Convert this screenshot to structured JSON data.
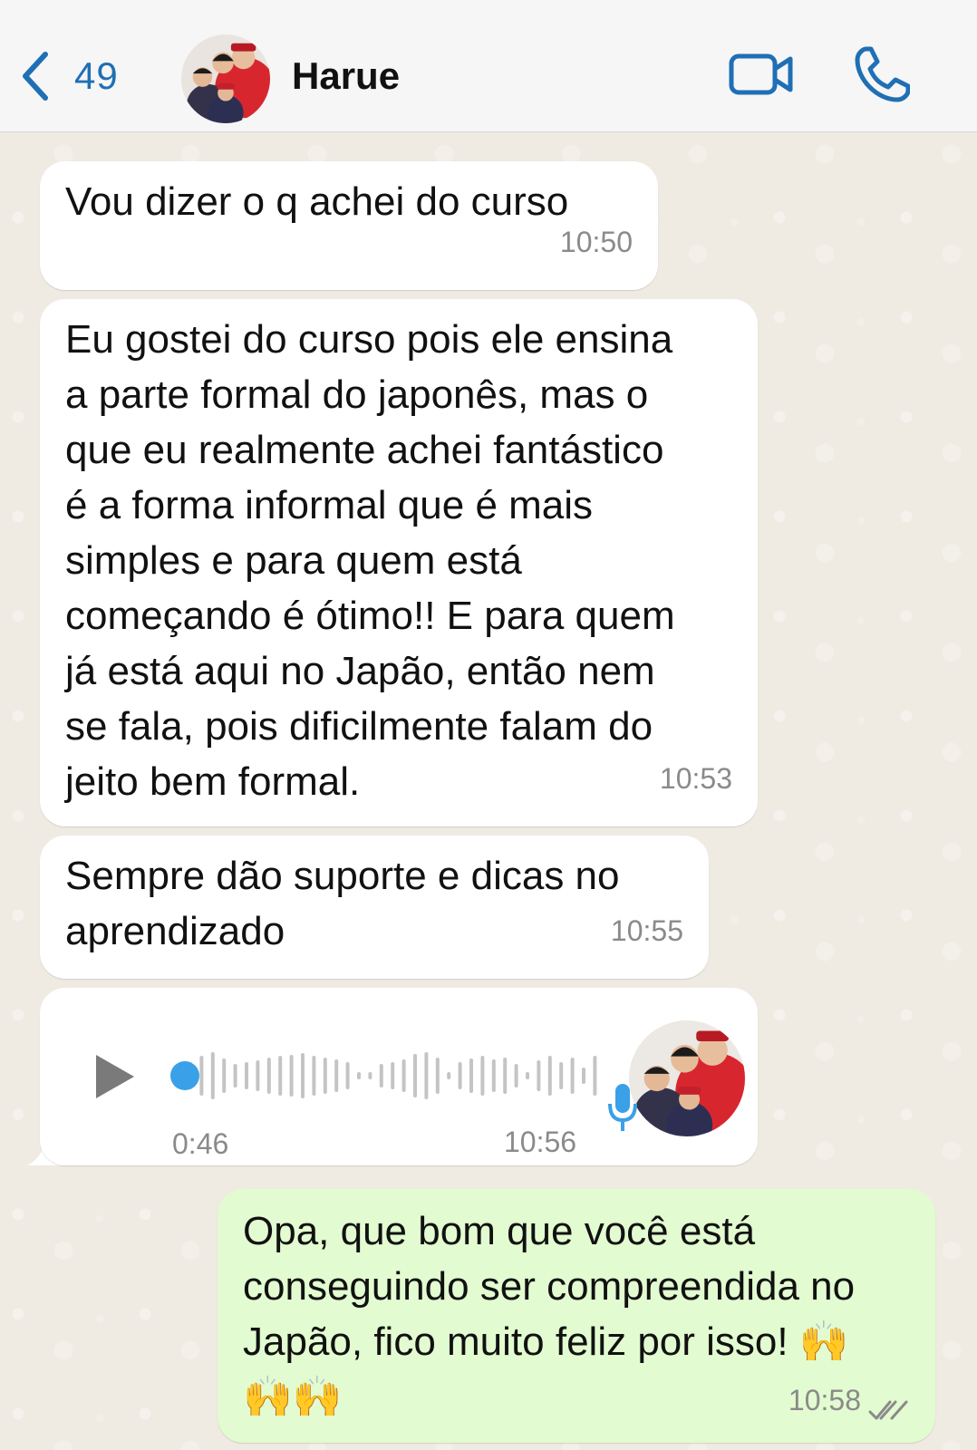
{
  "header": {
    "back_count": "49",
    "contact_name": "Harue",
    "back_icon": "chevron-left-icon",
    "video_icon": "video-camera-icon",
    "call_icon": "phone-icon",
    "accent_color": "#1f6fb5"
  },
  "messages": [
    {
      "direction": "incoming",
      "text": "Vou dizer o q achei do curso",
      "time": "10:50"
    },
    {
      "direction": "incoming",
      "text": "Eu gostei do curso pois ele ensina\na parte formal do japonês, mas o\nque eu realmente achei fantástico\né a forma informal que é mais\nsimples e para quem está\ncomeçando é ótimo!! E para quem\njá está aqui no Japão, então nem\nse fala, pois dificilmente falam do\njeito bem formal.",
      "time": "10:53"
    },
    {
      "direction": "incoming",
      "text": "Sempre dão suporte e dicas no\naprendizado",
      "time": "10:55"
    },
    {
      "direction": "incoming",
      "type": "voice",
      "duration": "0:46",
      "time": "10:56",
      "played_fraction": 0
    },
    {
      "direction": "outgoing",
      "text": "Opa, que bom que você está\nconseguindo ser compreendida no\nJapão, fico muito feliz por isso! 🙌\n🙌🙌",
      "time": "10:58",
      "status": "read"
    }
  ]
}
